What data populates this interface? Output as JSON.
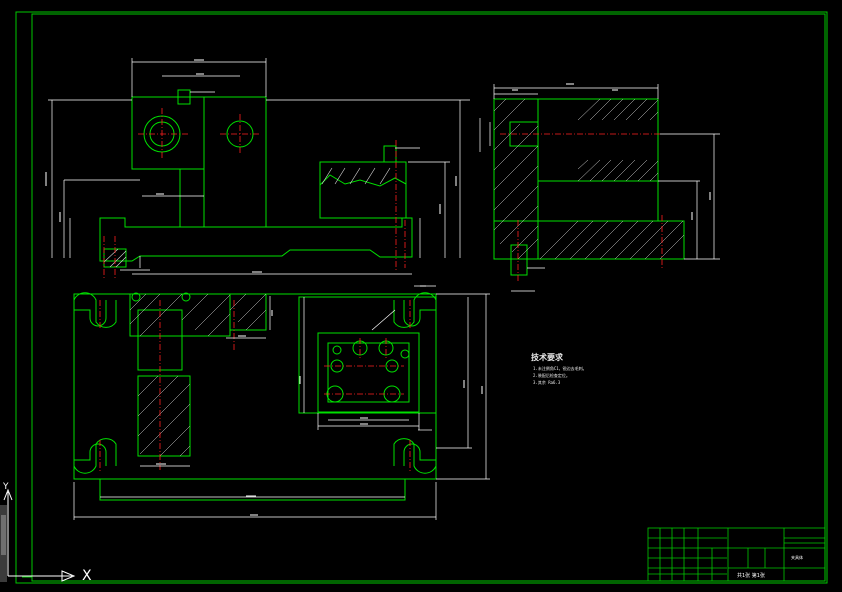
{
  "app": {
    "view": "model-space drawing canvas"
  },
  "colors": {
    "background": "#000000",
    "frame": "#00c800",
    "geometry": "#00e000",
    "centerline": "#ff2020",
    "dimension": "#ffffff",
    "hatch": "#d8d8d8",
    "ucs": "#ffffff"
  },
  "technical_notes": {
    "title": "技术要求",
    "lines": [
      "1.未注倒角C1，锐边去毛刺。",
      "2.装配后检查定位。",
      "3.其余 Ra6.3"
    ]
  },
  "title_block": {
    "drawing_name": "夹具体",
    "scale": "共1张 第1张"
  },
  "ucs": {
    "x_label": "X",
    "y_label": "Y"
  }
}
